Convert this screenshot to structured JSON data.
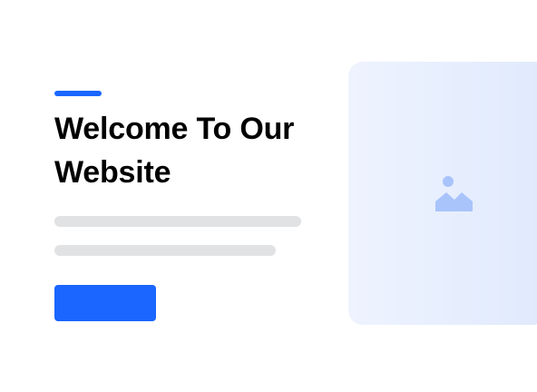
{
  "hero": {
    "title": "Welcome To Our Website",
    "button_label": ""
  },
  "colors": {
    "accent": "#1a66ff",
    "placeholder_line": "#e1e2e4",
    "image_bg": "#e6eefd",
    "image_icon": "#a9c4fb"
  },
  "icons": {
    "image": "image-icon"
  }
}
